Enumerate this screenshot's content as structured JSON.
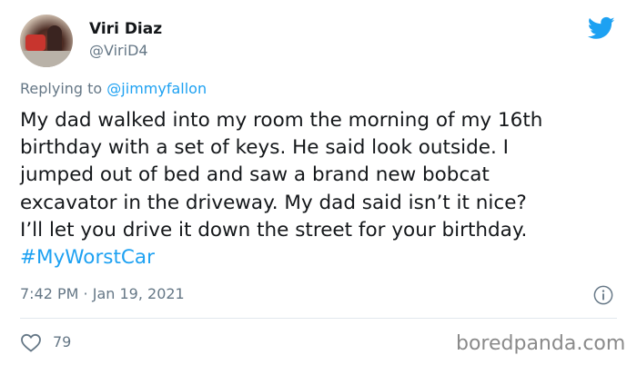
{
  "author": {
    "name": "Viri Diaz",
    "handle": "@ViriD4",
    "avatar_icon": "user-avatar-photo"
  },
  "brand": {
    "icon": "twitter-bird-icon",
    "color": "#1da1f2"
  },
  "reply": {
    "prefix": "Replying to ",
    "mention": "@jimmyfallon"
  },
  "tweet": {
    "lines": [
      "My dad walked into my room the morning of my 16th",
      "birthday with a set of keys. He said look outside. I",
      "jumped out of bed and saw a brand new bobcat",
      "excavator in the driveway. My dad said isn’t it nice?",
      "I’ll let you drive it down the street for your birthday."
    ],
    "hashtag": "#MyWorstCar"
  },
  "meta": {
    "timestamp": "7:42 PM · Jan 19, 2021",
    "info_icon": "info-icon"
  },
  "engagement": {
    "likes": "79",
    "like_icon": "heart-icon"
  },
  "watermark": "boredpanda.com"
}
